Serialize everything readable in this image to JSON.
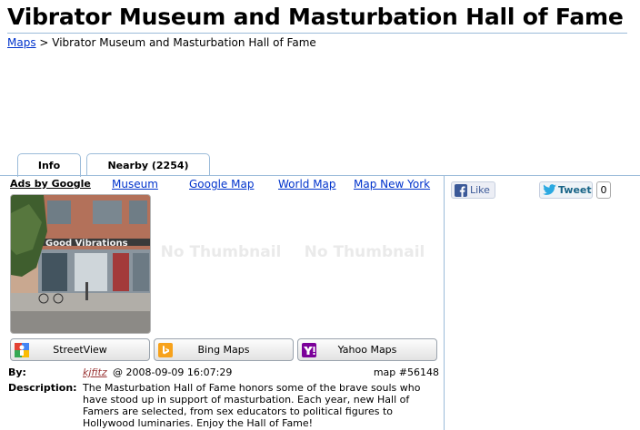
{
  "page": {
    "title": "Vibrator Museum and Masturbation Hall of Fame",
    "breadcrumb_link": "Maps",
    "breadcrumb_separator": " > ",
    "breadcrumb_current": "Vibrator Museum and Masturbation Hall of Fame"
  },
  "tabs": [
    {
      "label": "Info",
      "active": true
    },
    {
      "label": "Nearby (2254)",
      "active": false
    }
  ],
  "ads": {
    "label": "Ads by Google",
    "links": [
      "Museum",
      "Google Map",
      "World Map",
      "Map New York"
    ]
  },
  "thumbnail": {
    "sign_text": "Good Vibrations",
    "no_thumbnail_1": "No Thumbnail",
    "no_thumbnail_2": "No Thumbnail"
  },
  "map_buttons": [
    {
      "label": "StreetView",
      "icon": "google-streetview-icon"
    },
    {
      "label": "Bing Maps",
      "icon": "bing-icon"
    },
    {
      "label": "Yahoo Maps",
      "icon": "yahoo-icon"
    }
  ],
  "details": {
    "by_label": "By:",
    "author": "kjfitz",
    "posted": "@ 2008-09-09 16:07:29",
    "map_number": "map #56148",
    "description_label": "Description:",
    "description": "The Masturbation Hall of Fame honors some of the brave souls who have stood up in support of masturbation. Each year, new Hall of Famers are selected, from sex educators to political figures to Hollywood luminaries. Enjoy the Hall of Fame!"
  },
  "social": {
    "like_label": "Like",
    "tweet_label": "Tweet",
    "tweet_count": "0"
  },
  "colors": {
    "link": "#0033cc",
    "border": "#9bbbd9"
  }
}
